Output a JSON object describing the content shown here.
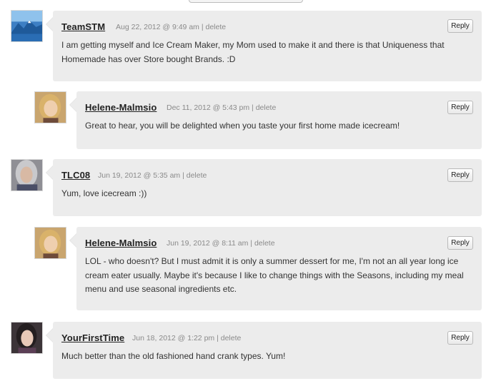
{
  "comments": [
    {
      "author": "TeamSTM",
      "date": "Aug 22, 2012 @ 9:49 am",
      "sep": "|",
      "delete": "delete",
      "reply": "Reply",
      "text": "I am getting myself and Ice Cream Maker, my Mom used to make it and there is that Uniqueness that Homemade has over Store bought Brands. :D"
    },
    {
      "author": "Helene-Malmsio",
      "date": "Dec 11, 2012 @ 5:43 pm",
      "sep": "|",
      "delete": "delete",
      "reply": "Reply",
      "text": "Great to hear, you will be delighted when you taste your first home made icecream!"
    },
    {
      "author": "TLC08",
      "date": "Jun 19, 2012 @ 5:35 am",
      "sep": "|",
      "delete": "delete",
      "reply": "Reply",
      "text": "Yum, love icecream :))"
    },
    {
      "author": "Helene-Malmsio",
      "date": "Jun 19, 2012 @ 8:11 am",
      "sep": "|",
      "delete": "delete",
      "reply": "Reply",
      "text": "LOL - who doesn't? But I must admit it is only a summer dessert for me, I'm not an all year long ice cream eater usually. Maybe it's because I like to change things with the Seasons, including my meal menu and use seasonal ingredients etc."
    },
    {
      "author": "YourFirstTime",
      "date": "Jun 18, 2012 @ 1:22 pm",
      "sep": "|",
      "delete": "delete",
      "reply": "Reply",
      "text": "Much better than the old fashioned hand crank types. Yum!"
    }
  ],
  "icons": {
    "avatar_1": "landscape-avatar",
    "avatar_2": "woman-blonde-avatar",
    "avatar_3": "woman-gray-hair-avatar",
    "avatar_4": "woman-blonde-avatar",
    "avatar_5": "woman-dark-hair-avatar"
  },
  "colors": {
    "bubble": "#ececec",
    "meta_text": "#8a8a8a",
    "author_text": "#222222"
  }
}
